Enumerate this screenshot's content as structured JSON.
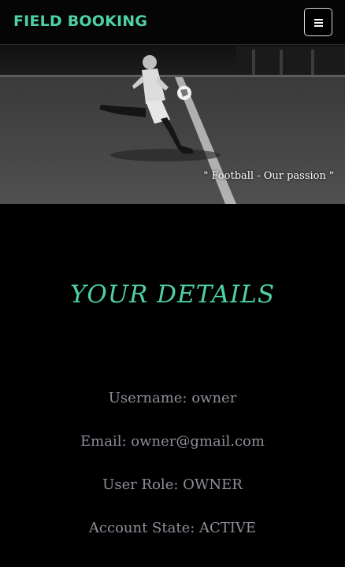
{
  "navbar": {
    "brand": "FIELD BOOKING",
    "menu_icon": "hamburger-menu-icon"
  },
  "hero": {
    "quote": "\" Football - Our passion \""
  },
  "main": {
    "title": "YOUR DETAILS",
    "details": [
      "Username: owner",
      "Email: owner@gmail.com",
      "User Role: OWNER",
      "Account State: ACTIVE"
    ]
  },
  "colors": {
    "accent": "#4fd1a3",
    "background": "#000000",
    "detail_text": "#8c8f99"
  }
}
